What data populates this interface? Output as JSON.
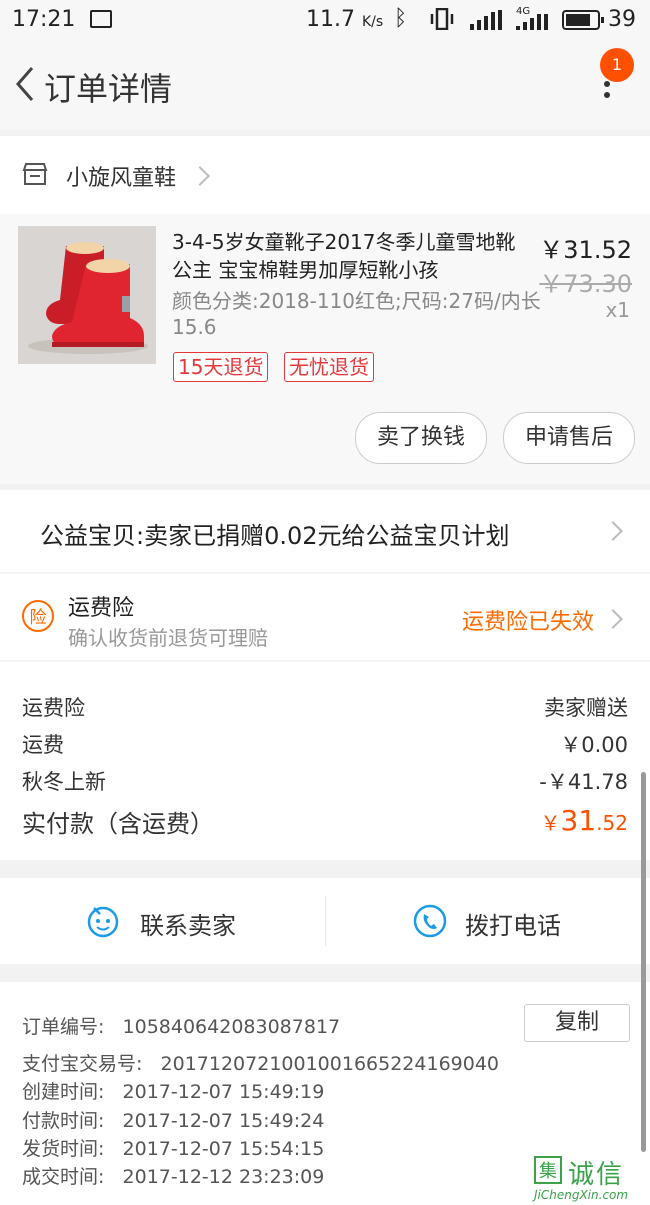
{
  "status_bar": {
    "time": "17:21",
    "net_speed": "11.7",
    "net_unit": "K/s",
    "network_type": "4G",
    "battery": "39"
  },
  "header": {
    "title": "订单详情",
    "badge_count": "1"
  },
  "shop": {
    "name": "小旋风童鞋"
  },
  "product": {
    "title": "3-4-5岁女童靴子2017冬季儿童雪地靴公主 宝宝棉鞋男加厚短靴小孩",
    "sku": "颜色分类:2018-110红色;尺码:27码/内长15.6",
    "price": "￥31.52",
    "original_price": "￥73.30",
    "quantity": "x1",
    "tags": [
      "15天退货",
      "无忧退货"
    ],
    "image_colors": {
      "boot": "#d9232e",
      "fur": "#f3d3a8",
      "bg": "#d8d5d2"
    }
  },
  "actions": {
    "sell_label": "卖了换钱",
    "aftersale_label": "申请售后"
  },
  "charity": {
    "text": "公益宝贝:卖家已捐赠0.02元给公益宝贝计划"
  },
  "insurance": {
    "icon_text": "险",
    "title": "运费险",
    "subtitle": "确认收货前退货可理赔",
    "status": "运费险已失效"
  },
  "fees": {
    "rows": [
      {
        "label": "运费险",
        "value": "卖家赠送"
      },
      {
        "label": "运费",
        "value": "￥0.00"
      },
      {
        "label": "秋冬上新",
        "value": "-￥41.78"
      }
    ],
    "total_label": "实付款（含运费）",
    "total_symbol": "￥",
    "total_int": "31",
    "total_dec": ".52"
  },
  "contact": {
    "seller_label": "联系卖家",
    "phone_label": "拨打电话"
  },
  "order_info": {
    "copy_label": "复制",
    "lines": [
      {
        "label": "订单编号:",
        "value": "105840642083087817"
      },
      {
        "label": "支付宝交易号:",
        "value": "2017120721001001665224169040"
      },
      {
        "label": "创建时间:",
        "value": "2017-12-07 15:49:19"
      },
      {
        "label": "付款时间:",
        "value": "2017-12-07 15:49:24"
      },
      {
        "label": "发货时间:",
        "value": "2017-12-07 15:54:15"
      },
      {
        "label": "成交时间:",
        "value": "2017-12-12 23:23:09"
      }
    ]
  },
  "watermark": {
    "box_char": "集",
    "name": "诚信",
    "url": "JiChengXin.com"
  },
  "colors": {
    "accent": "#ff5000",
    "insurance": "#ff6a00",
    "tag_red": "#e4393c",
    "contact_blue": "#1a9be8"
  }
}
